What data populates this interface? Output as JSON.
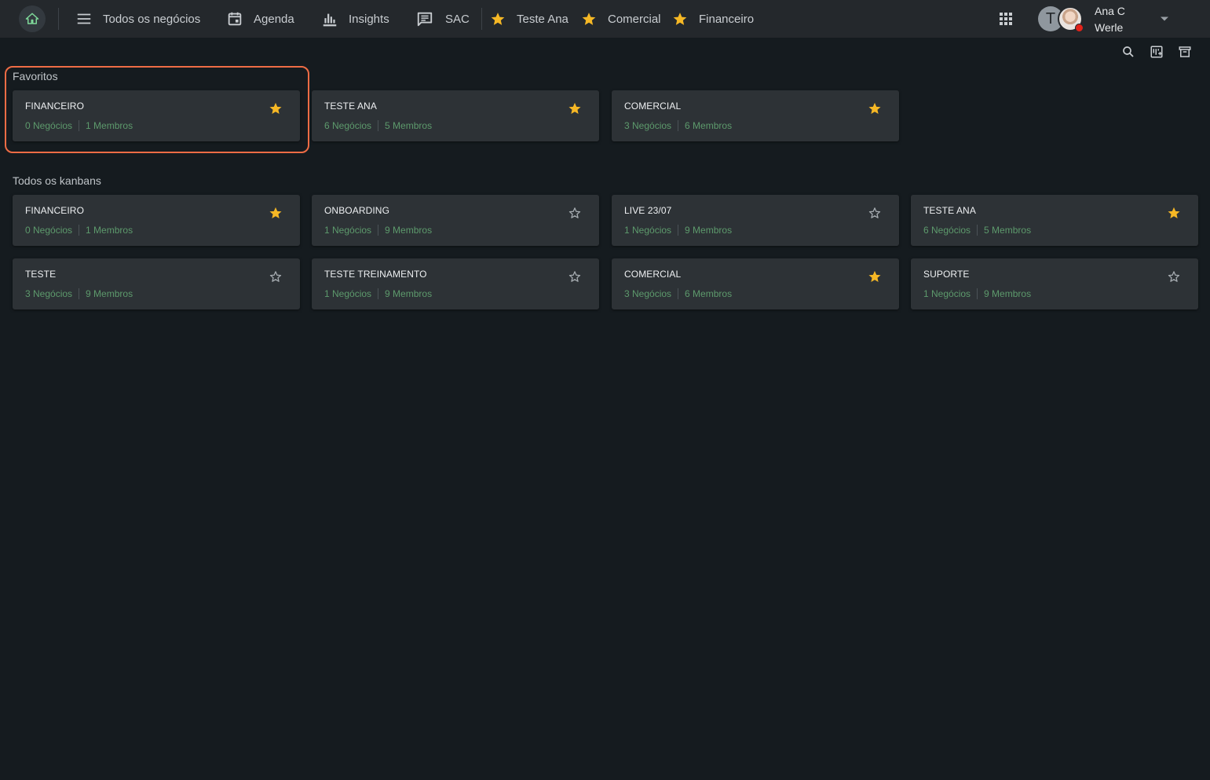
{
  "topbar": {
    "nav": [
      {
        "label": "Todos os negócios",
        "icon": "menu-icon"
      },
      {
        "label": "Agenda",
        "icon": "calendar-icon"
      },
      {
        "label": "Insights",
        "icon": "bar-chart-icon"
      },
      {
        "label": "SAC",
        "icon": "chat-icon"
      }
    ],
    "favorites": [
      {
        "label": "Teste Ana",
        "icon": "star-icon"
      },
      {
        "label": "Comercial",
        "icon": "star-icon"
      },
      {
        "label": "Financeiro",
        "icon": "star-icon"
      }
    ],
    "user": {
      "initial": "T",
      "name_line1": "Ana C",
      "name_line2": "Werle"
    }
  },
  "colors": {
    "accent_star": "#f6b825",
    "highlight": "#ee6c45",
    "meta_text": "#5d9a6c"
  },
  "favoritos": {
    "title": "Favoritos",
    "cards": [
      {
        "name": "FINANCEIRO",
        "negocios": "0 Negócios",
        "membros": "1 Membros",
        "starred": true
      },
      {
        "name": "TESTE ANA",
        "negocios": "6 Negócios",
        "membros": "5 Membros",
        "starred": true
      },
      {
        "name": "COMERCIAL",
        "negocios": "3 Negócios",
        "membros": "6 Membros",
        "starred": true
      }
    ]
  },
  "kanbans": {
    "title": "Todos os kanbans",
    "cards": [
      {
        "name": "FINANCEIRO",
        "negocios": "0 Negócios",
        "membros": "1 Membros",
        "starred": true
      },
      {
        "name": "ONBOARDING",
        "negocios": "1 Negócios",
        "membros": "9 Membros",
        "starred": false
      },
      {
        "name": "LIVE 23/07",
        "negocios": "1 Negócios",
        "membros": "9 Membros",
        "starred": false
      },
      {
        "name": "TESTE ANA",
        "negocios": "6 Negócios",
        "membros": "5 Membros",
        "starred": true
      },
      {
        "name": "TESTE",
        "negocios": "3 Negócios",
        "membros": "9 Membros",
        "starred": false
      },
      {
        "name": "TESTE TREINAMENTO",
        "negocios": "1 Negócios",
        "membros": "9 Membros",
        "starred": false
      },
      {
        "name": "COMERCIAL",
        "negocios": "3 Negócios",
        "membros": "6 Membros",
        "starred": true
      },
      {
        "name": "SUPORTE",
        "negocios": "1 Negócios",
        "membros": "9 Membros",
        "starred": false
      }
    ]
  }
}
